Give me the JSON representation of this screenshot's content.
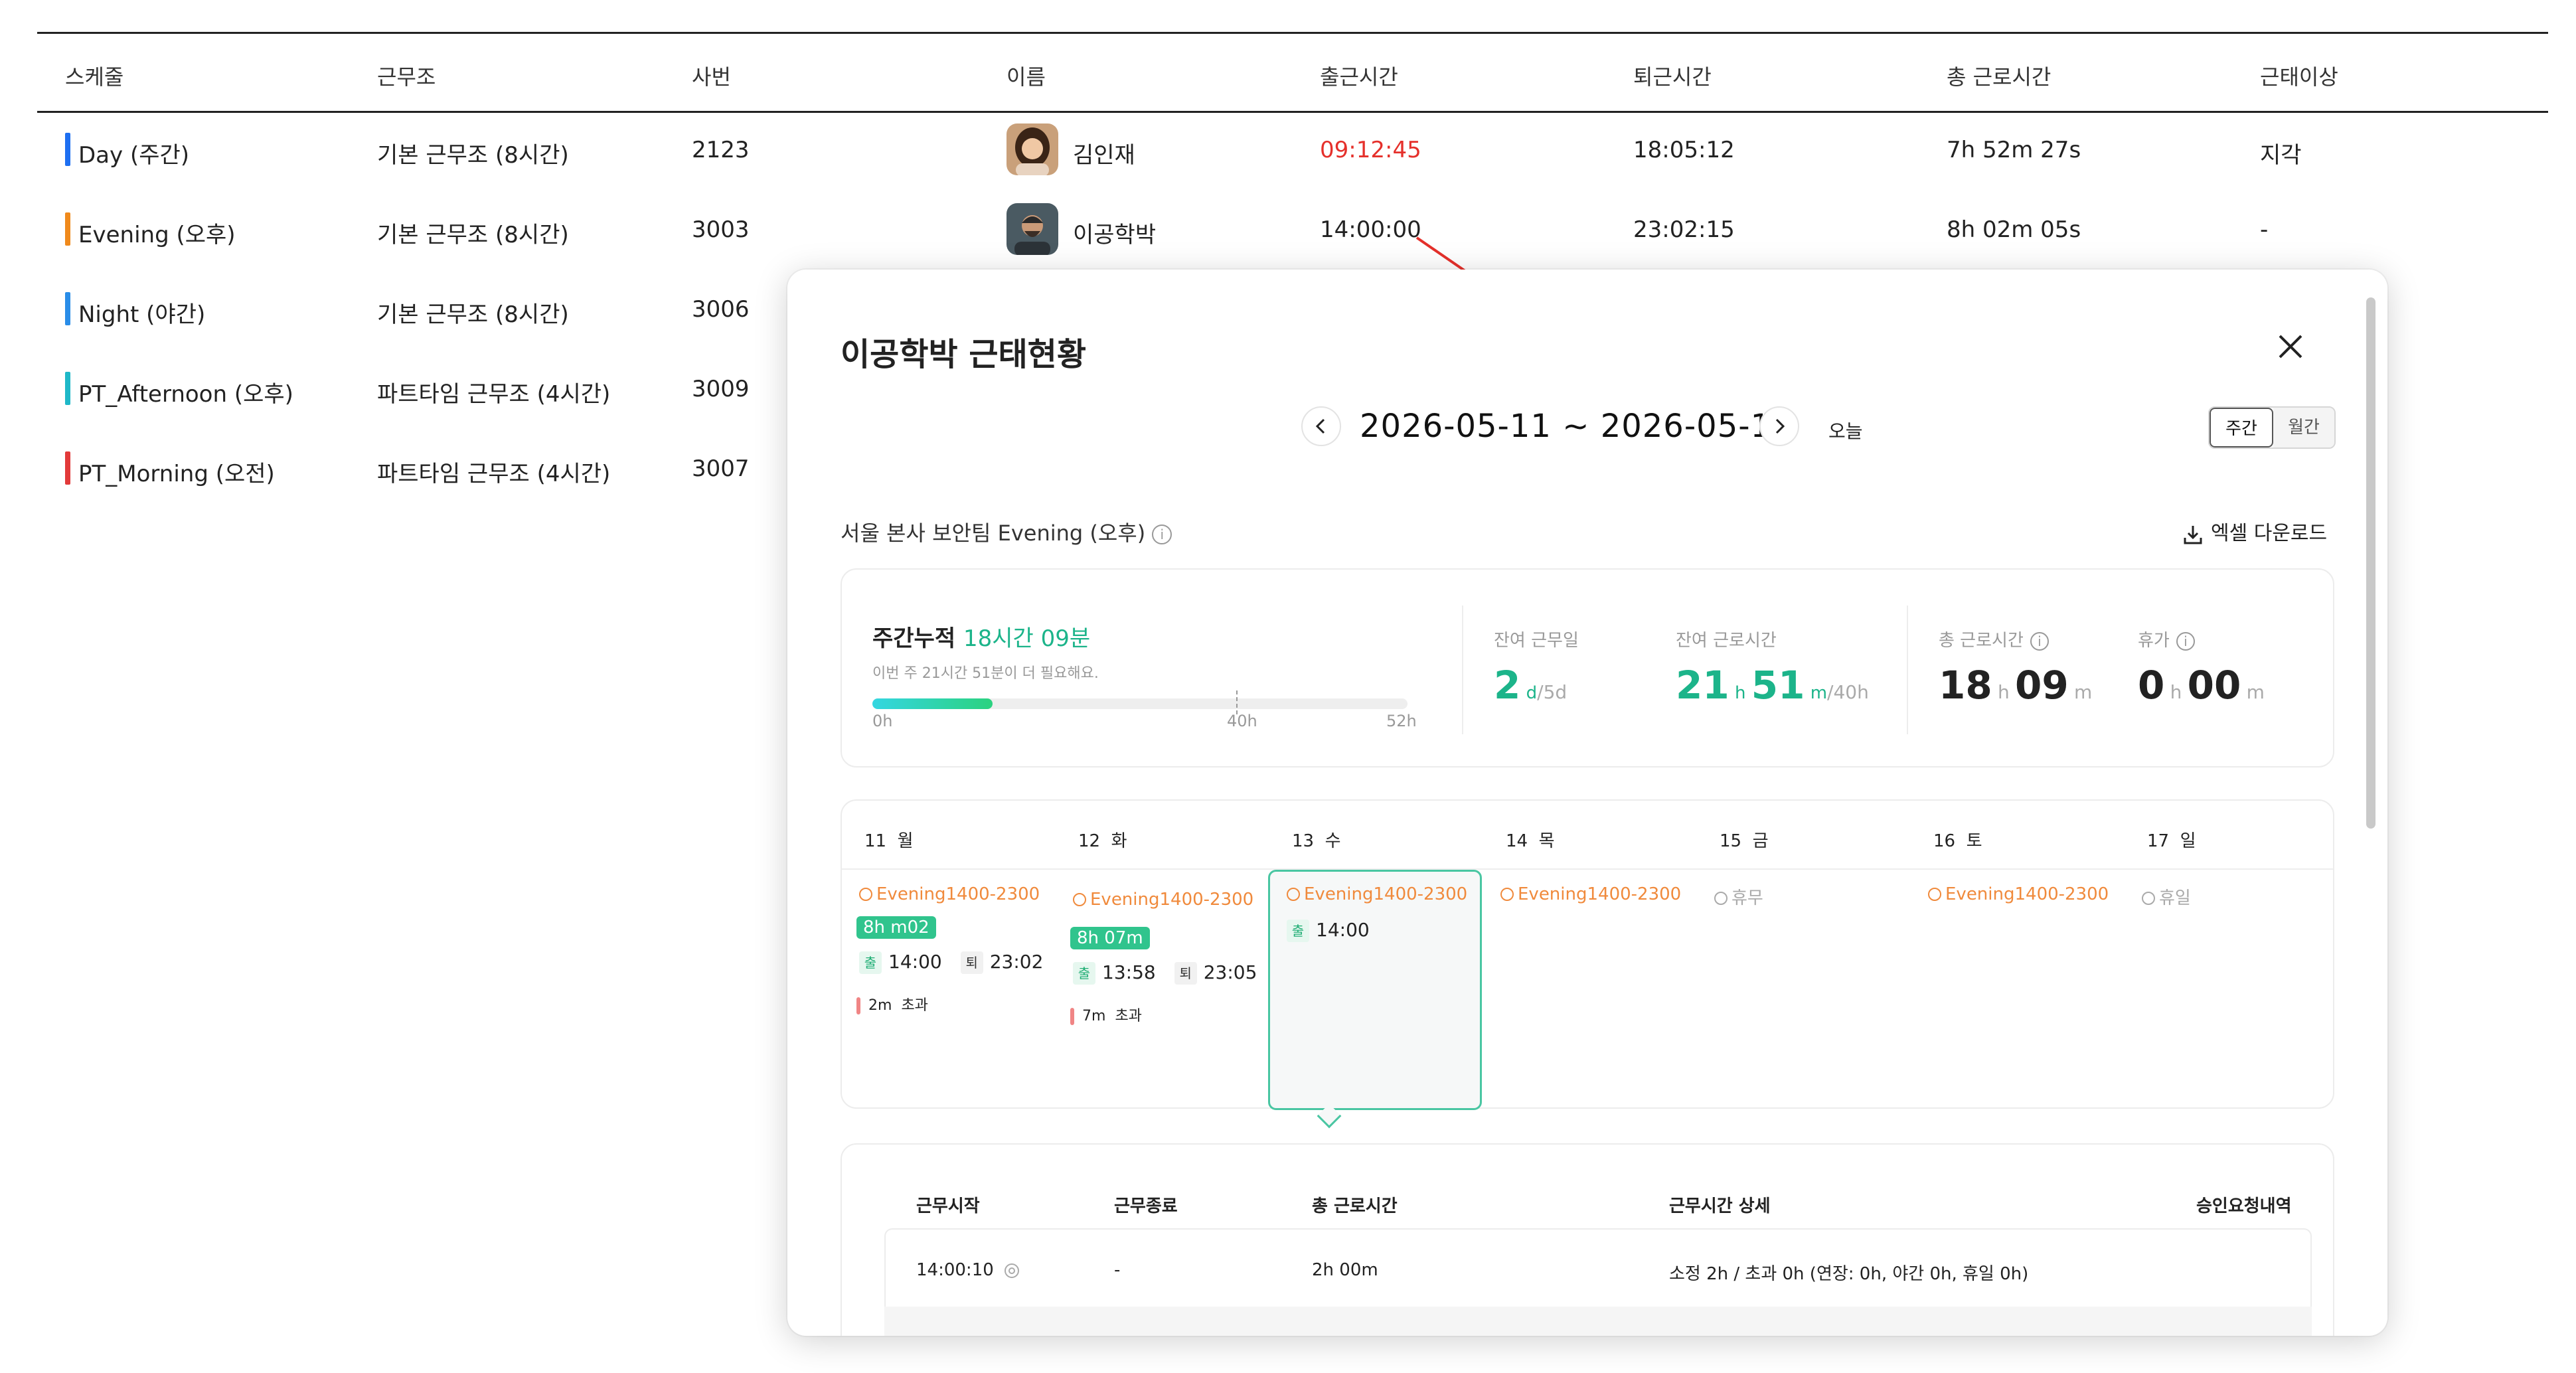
{
  "table": {
    "headers": [
      "스케줄",
      "근무조",
      "사번",
      "이름",
      "출근시간",
      "퇴근시간",
      "총 근로시간",
      "근태이상"
    ],
    "rows": [
      {
        "schedule": "Day (주간)",
        "color": "#1e6ff1",
        "shift": "기본 근무조 (8시간)",
        "emp_no": "2123",
        "name": "김인재",
        "in": "09:12:45",
        "out": "18:05:12",
        "total": "7h 52m 27s",
        "issue": "지각"
      },
      {
        "schedule": "Evening (오후)",
        "color": "#f08a1c",
        "shift": "기본 근무조 (8시간)",
        "emp_no": "3003",
        "name": "이공학박",
        "in": "14:00:00",
        "out": "23:02:15",
        "total": "8h 02m 05s",
        "issue": "-"
      },
      {
        "schedule": "Night (야간)",
        "color": "#2a8de8",
        "shift": "기본 근무조 (8시간)",
        "emp_no": "3006"
      },
      {
        "schedule": "PT_Afternoon (오후)",
        "color": "#1fb8c8",
        "shift": "파트타임 근무조 (4시간)",
        "emp_no": "3009"
      },
      {
        "schedule": "PT_Morning (오전)",
        "color": "#e23a3a",
        "shift": "파트타임 근무조 (4시간)",
        "emp_no": "3007"
      }
    ]
  },
  "modal": {
    "title": "이공학박 근태현황",
    "date_range": "2026-05-11 ~ 2026-05-17",
    "today": "오늘",
    "view_week": "주간",
    "view_month": "월간",
    "team": "서울 본사 보안팀 Evening (오후)",
    "excel": "엑셀 다운로드",
    "summary": {
      "acc_label": "주간누적",
      "acc_value": "18시간 09분",
      "note": "이번 주 21시간 51분이 더 필요해요.",
      "progress": 0.224,
      "marker_hours": 40,
      "ticks": [
        "0h",
        "40h",
        "52h"
      ],
      "remain_days_label": "잔여 근무일",
      "remain_days": "2",
      "remain_days_unit": "d",
      "remain_days_total": "/5d",
      "remain_hours_label": "잔여 근로시간",
      "remain_h": "21",
      "remain_m": "51",
      "remain_total": "/40h",
      "total_label": "총 근로시간",
      "total_h": "18",
      "total_m": "09",
      "leave_label": "휴가",
      "leave_h": "0",
      "leave_m": "00",
      "unit_h": "h",
      "unit_m": "m"
    },
    "days": [
      {
        "num": "11",
        "dow": "월",
        "shift": "Evening1400-2300",
        "badge": "8h m02",
        "in_label": "출",
        "in": "14:00",
        "out_label": "퇴",
        "out": "23:02",
        "over": "2m",
        "over_label": "초과"
      },
      {
        "num": "12",
        "dow": "화",
        "shift": "Evening1400-2300",
        "badge": "8h 07m",
        "in_label": "출",
        "in": "13:58",
        "out_label": "퇴",
        "out": "23:05",
        "over": "7m",
        "over_label": "초과"
      },
      {
        "num": "13",
        "dow": "수",
        "shift": "Evening1400-2300",
        "in_label": "출",
        "in": "14:00"
      },
      {
        "num": "14",
        "dow": "목",
        "shift": "Evening1400-2300"
      },
      {
        "num": "15",
        "dow": "금",
        "shift": "휴무"
      },
      {
        "num": "16",
        "dow": "토",
        "shift": "Evening1400-2300"
      },
      {
        "num": "17",
        "dow": "일",
        "shift": "휴일"
      }
    ],
    "detail": {
      "headers": [
        "근무시작",
        "근무종료",
        "총 근로시간",
        "근무시간 상세",
        "승인요청내역"
      ],
      "row": {
        "start": "14:00:10",
        "end": "-",
        "total": "2h 00m",
        "detail": "소정 2h / 초과 0h (연장: 0h, 야간 0h, 휴일 0h)"
      }
    }
  }
}
